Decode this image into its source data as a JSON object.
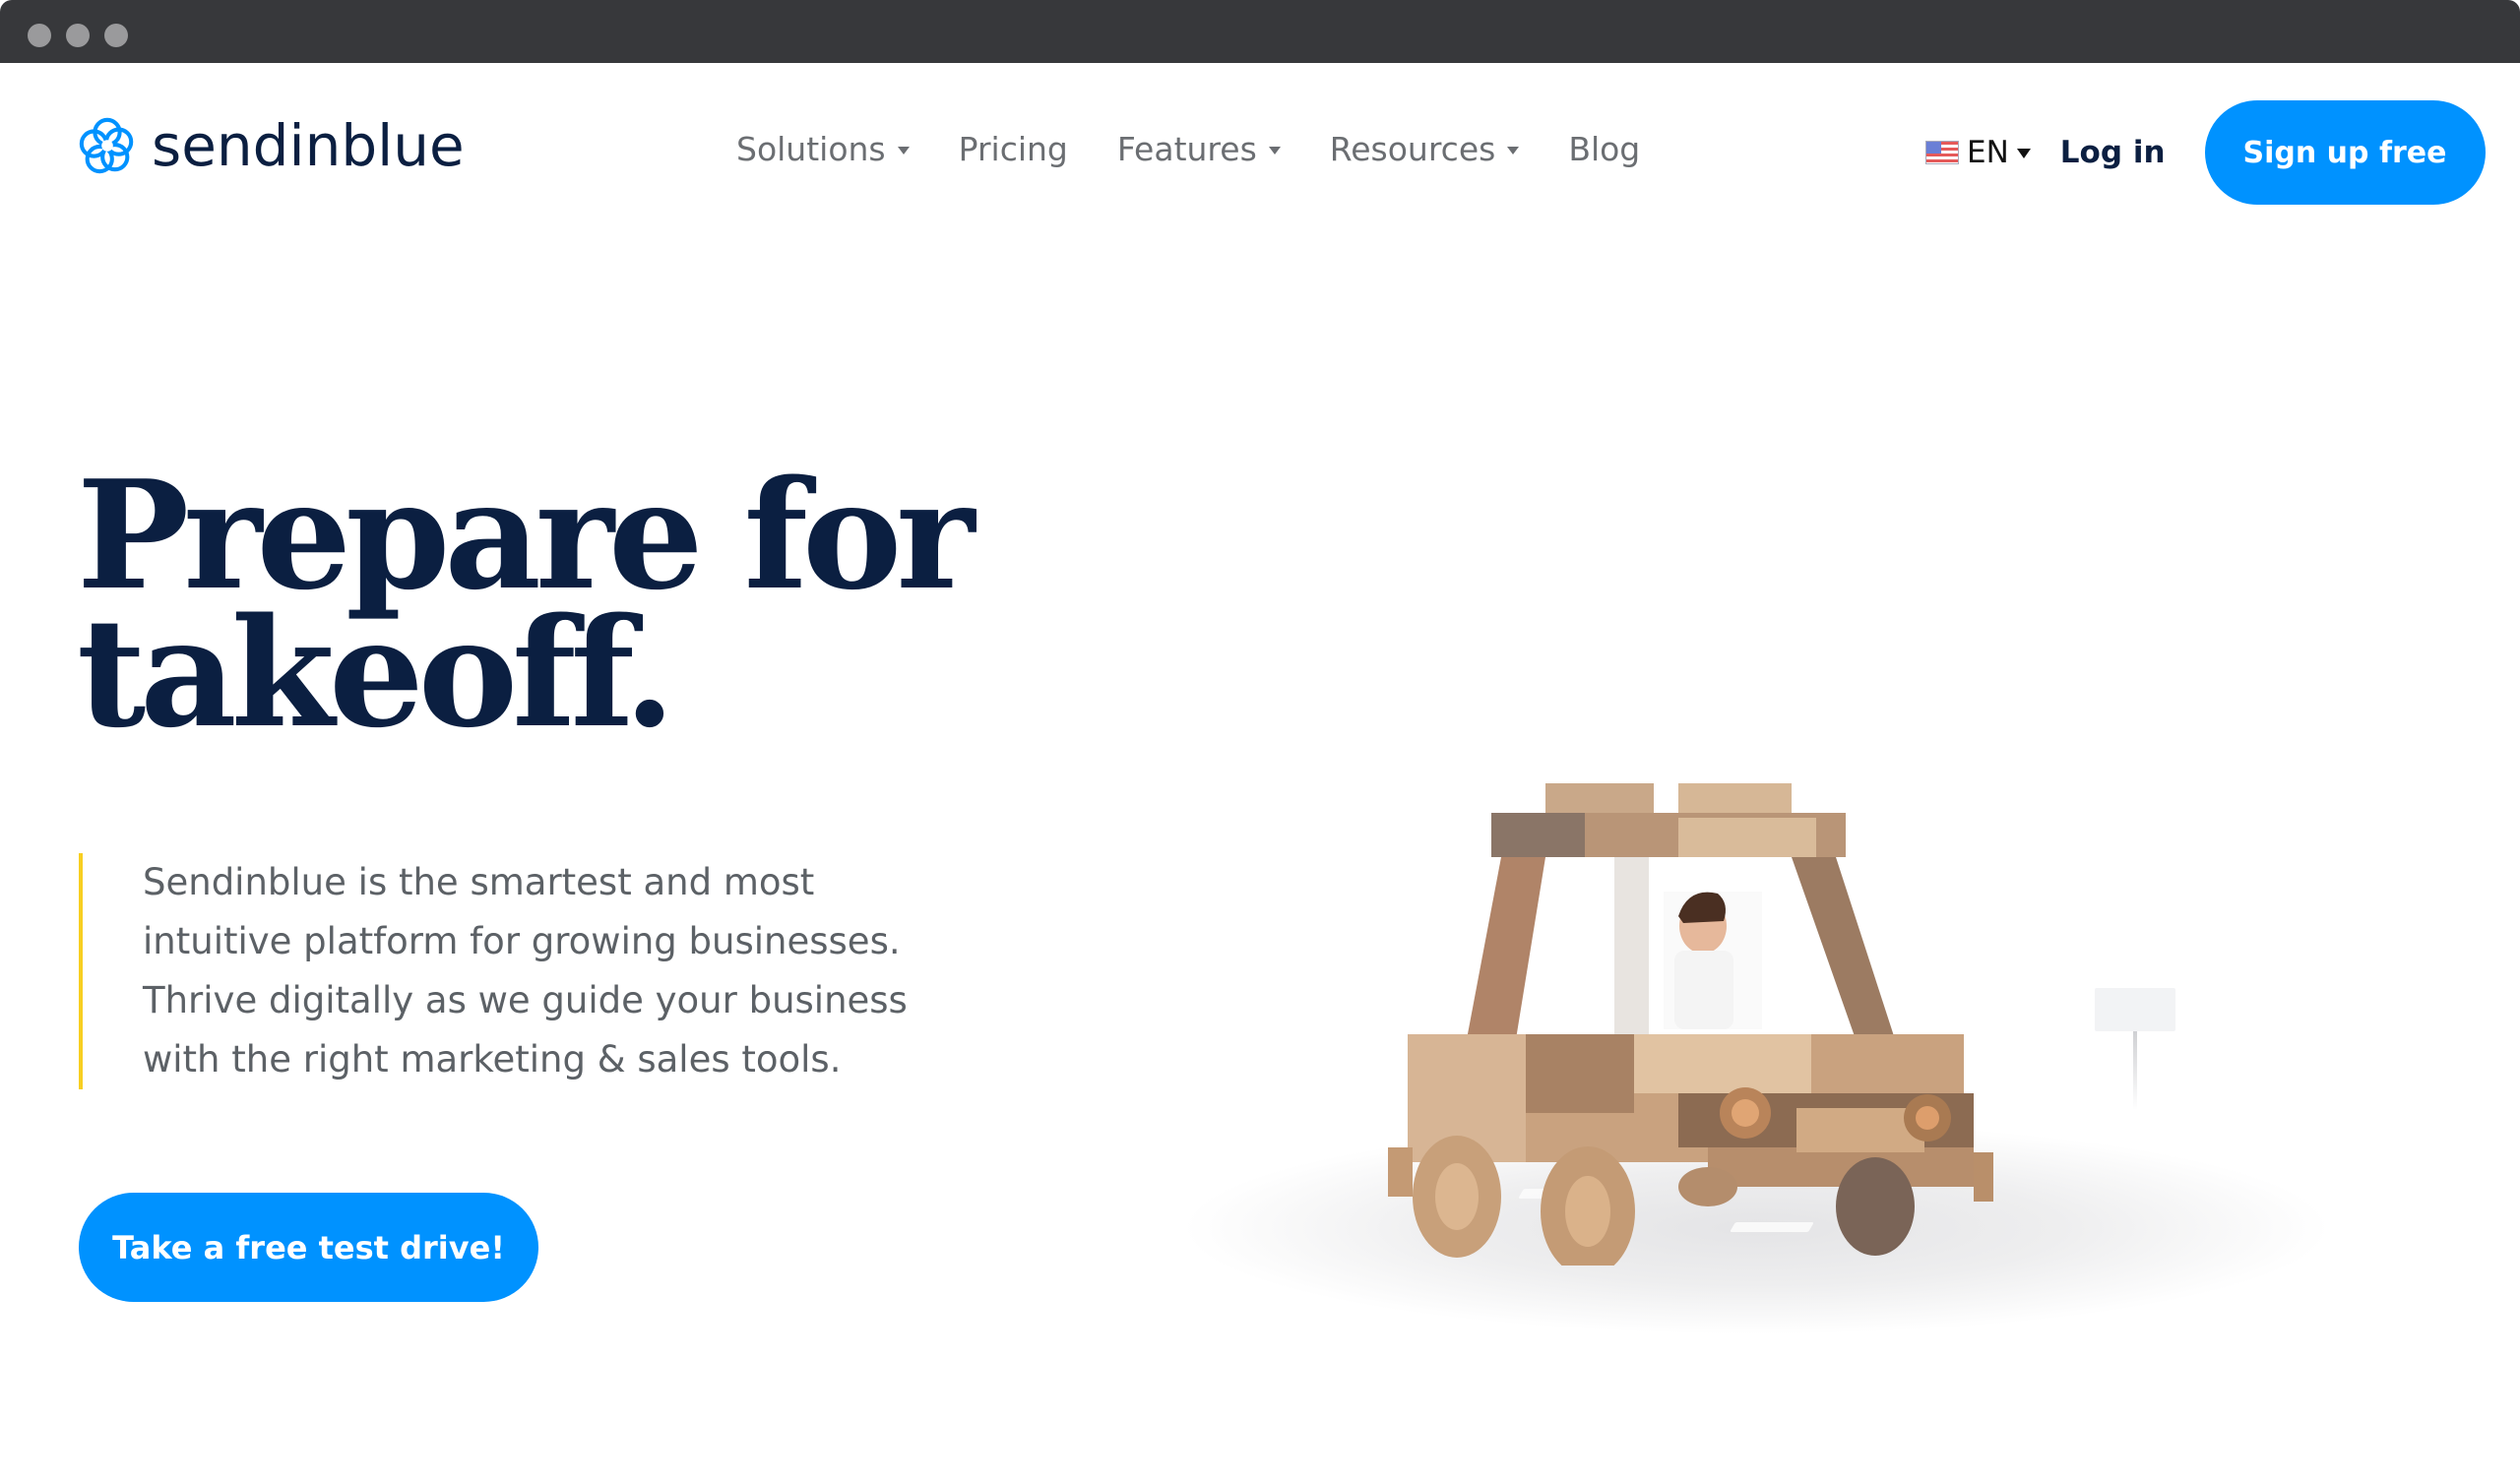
{
  "window": {
    "controls": [
      "close",
      "minimize",
      "maximize"
    ]
  },
  "header": {
    "logo_text": "sendinblue",
    "logo_icon": "sendinblue-spiral-icon",
    "nav": [
      {
        "label": "Solutions",
        "has_dropdown": true
      },
      {
        "label": "Pricing",
        "has_dropdown": false
      },
      {
        "label": "Features",
        "has_dropdown": true
      },
      {
        "label": "Resources",
        "has_dropdown": true
      },
      {
        "label": "Blog",
        "has_dropdown": false
      }
    ],
    "language": {
      "flag_icon": "us-flag-icon",
      "code": "EN"
    },
    "login_label": "Log in",
    "signup_label": "Sign up free"
  },
  "hero": {
    "title_line1": "Prepare for",
    "title_line2": "takeoff.",
    "description_lines": [
      "Sendinblue is the smartest and most",
      "intuitive platform for growing businesses.",
      "Thrive digitally as we guide your business",
      "with the right marketing & sales tools."
    ],
    "cta_label": "Take a free test drive!",
    "illustration": "wooden-toy-car-with-driver"
  },
  "colors": {
    "brand_blue": "#0092ff",
    "navy": "#0b1f41",
    "accent_yellow": "#f8cf21",
    "body_text": "#5c6166",
    "nav_text": "#6b6e72",
    "chrome_bar": "#37383b"
  }
}
